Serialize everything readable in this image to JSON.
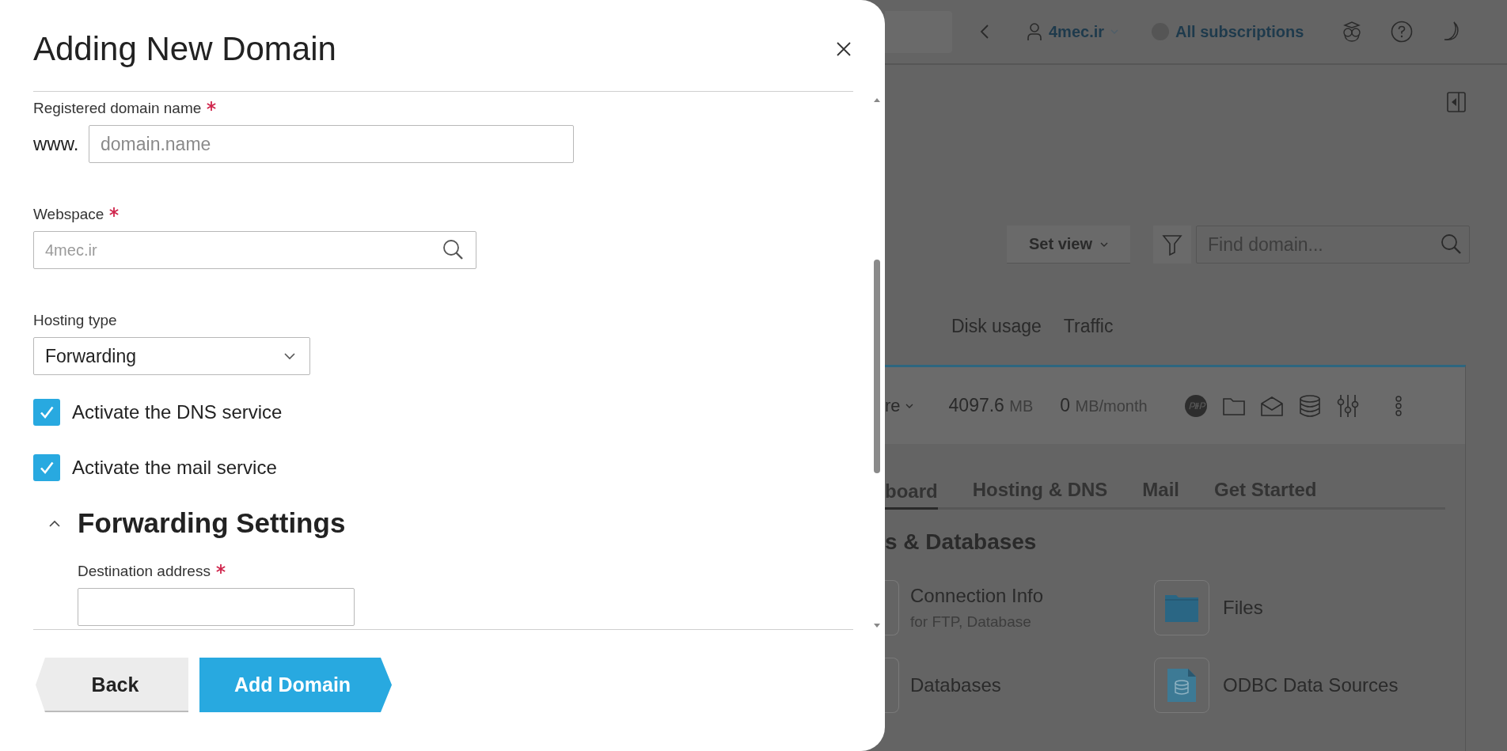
{
  "dialog": {
    "title": "Adding New Domain",
    "fields": [
      {
        "kind": "prefixed",
        "label": "Registered domain name",
        "required": true,
        "prefix": "www.",
        "placeholder": "domain.name"
      },
      {
        "kind": "search",
        "label": "Webspace",
        "required": true,
        "value": "4mec.ir"
      },
      {
        "kind": "select",
        "label": "Hosting type",
        "required": false,
        "value": "Forwarding"
      }
    ],
    "checkboxes": [
      {
        "label": "Activate the DNS service",
        "checked": true
      },
      {
        "label": "Activate the mail service",
        "checked": true
      }
    ],
    "section": {
      "title": "Forwarding Settings",
      "expanded": true,
      "field": {
        "label": "Destination address",
        "required": true
      }
    },
    "buttons": [
      {
        "label": "Back",
        "kind": "back"
      },
      {
        "label": "Add Domain",
        "kind": "primary"
      }
    ]
  },
  "background": {
    "top_bar": {
      "account": "4mec.ir",
      "subscriptions": "All subscriptions"
    },
    "toolbar": {
      "set_view": "Set view",
      "search": {
        "placeholder": "Find domain..."
      }
    },
    "columns": [
      "Disk usage",
      "Traffic"
    ],
    "domain_row": {
      "status": "re",
      "disk": "4097.6",
      "disk_unit": "MB",
      "traffic": "0",
      "traffic_unit": "MB/month"
    },
    "tabs": [
      {
        "label": "board",
        "selected": true
      },
      {
        "label": "Hosting & DNS",
        "selected": false
      },
      {
        "label": "Mail",
        "selected": false
      },
      {
        "label": "Get Started",
        "selected": false
      }
    ],
    "section_title": "s & Databases",
    "tiles": [
      {
        "title": "Connection Info",
        "subtitle": "for FTP, Database",
        "kind": "cut"
      },
      {
        "title": "Files",
        "kind": "folder"
      },
      {
        "title": "Databases",
        "kind": "cut"
      },
      {
        "title": "ODBC Data Sources",
        "kind": "document"
      }
    ]
  }
}
